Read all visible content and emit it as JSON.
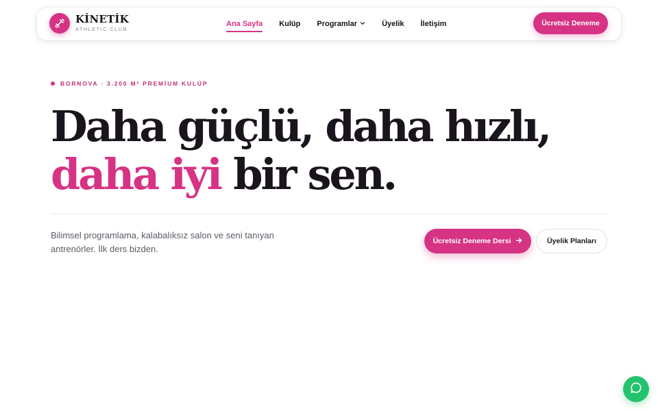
{
  "brand": {
    "name": "KİNETİK",
    "tagline": "ATHLETIC CLUB",
    "logo_icon": "dumbbell-icon"
  },
  "nav": {
    "items": [
      {
        "label": "Ana Sayfa",
        "active": true
      },
      {
        "label": "Kulüp",
        "active": false
      },
      {
        "label": "Programlar",
        "active": false,
        "dropdown": true
      },
      {
        "label": "Üyelik",
        "active": false
      },
      {
        "label": "İletişim",
        "active": false
      }
    ],
    "cta_label": "Ücretsiz Deneme"
  },
  "hero": {
    "eyebrow": "BORNOVA · 3.200 M² PREMİUM KULÜP",
    "headline_part1": "Daha güçlü, daha hızlı,",
    "headline_accent": "daha iyi",
    "headline_part2": "bir sen.",
    "lead": "Bilimsel programlama, kalabalıksız salon ve seni tanıyan antrenörler. İlk ders bizden.",
    "primary_button": "Ücretsiz Deneme Dersi",
    "secondary_button": "Üyelik Planları"
  },
  "chat": {
    "icon": "chat-bubble-icon"
  },
  "colors": {
    "accent": "#d63384",
    "text": "#1a141c",
    "muted": "#5e5864",
    "chat": "#25c26e"
  }
}
